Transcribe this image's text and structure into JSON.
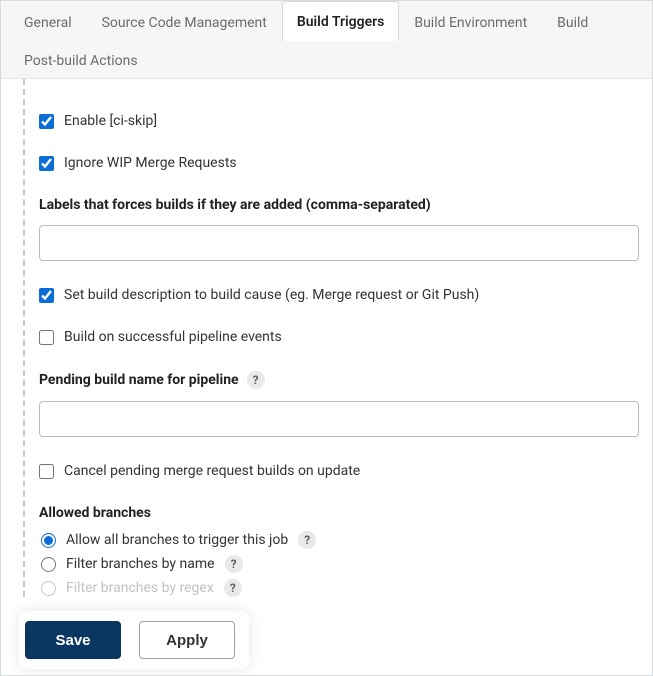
{
  "tabs": {
    "general": "General",
    "scm": "Source Code Management",
    "triggers": "Build Triggers",
    "env": "Build Environment",
    "build": "Build",
    "post": "Post-build Actions"
  },
  "fields": {
    "enableCiSkip": {
      "label": "Enable [ci-skip]",
      "checked": true
    },
    "ignoreWip": {
      "label": "Ignore WIP Merge Requests",
      "checked": true
    },
    "labelsHeading": "Labels that forces builds if they are added (comma-separated)",
    "labelsValue": "",
    "setBuildDesc": {
      "label": "Set build description to build cause (eg. Merge request or Git Push)",
      "checked": true
    },
    "buildOnPipeline": {
      "label": "Build on successful pipeline events",
      "checked": false
    },
    "pendingHeading": "Pending build name for pipeline",
    "pendingValue": "",
    "cancelPending": {
      "label": "Cancel pending merge request builds on update",
      "checked": false
    },
    "allowedHeading": "Allowed branches",
    "radios": {
      "allowAll": "Allow all branches to trigger this job",
      "byName": "Filter branches by name",
      "byRegex": "Filter branches by regex",
      "selected": "allowAll"
    }
  },
  "buttons": {
    "save": "Save",
    "apply": "Apply"
  },
  "helpGlyph": "?"
}
